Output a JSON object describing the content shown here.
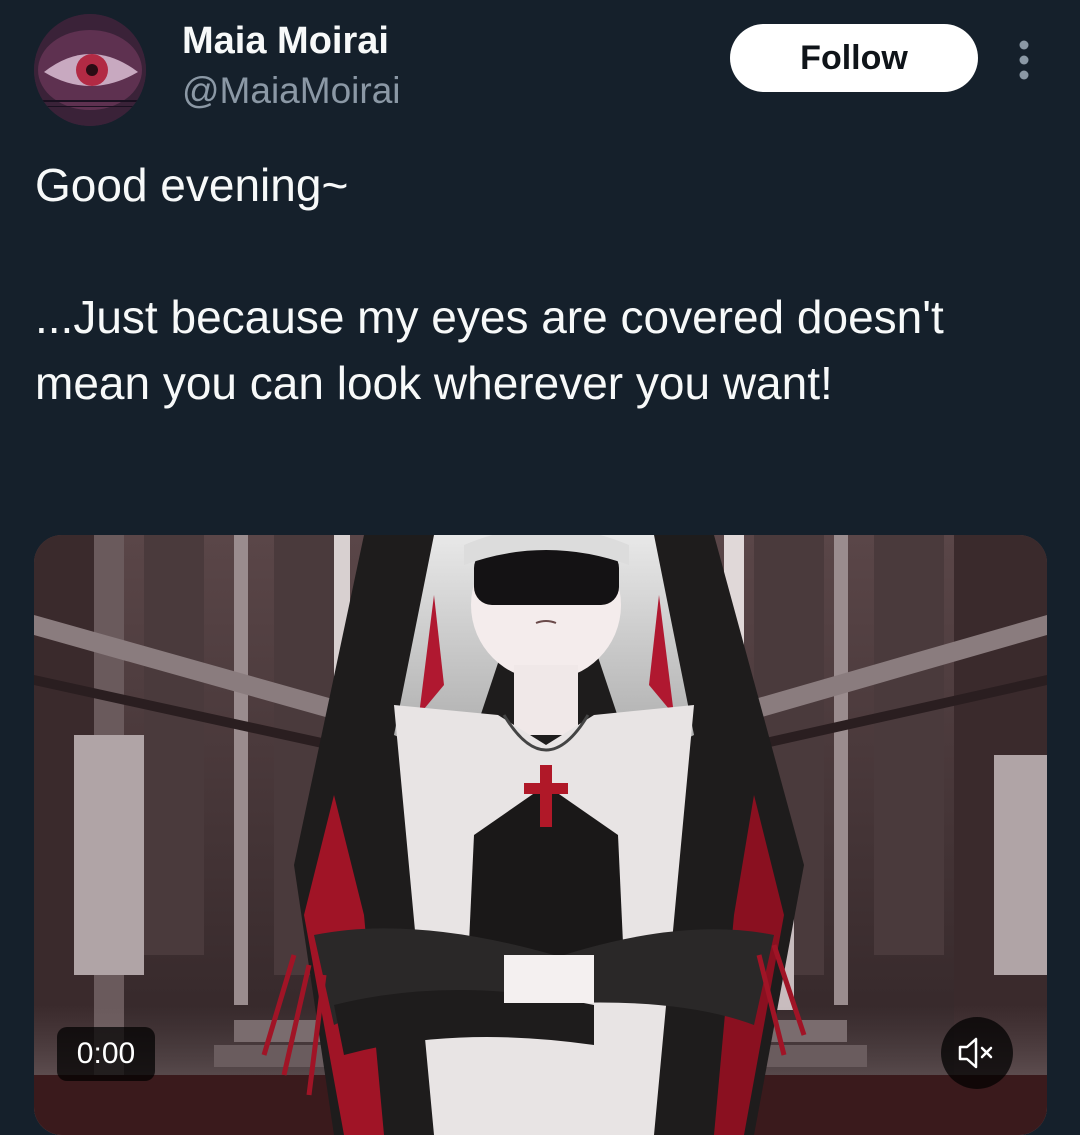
{
  "author": {
    "display_name": "Maia Moirai",
    "handle": "@MaiaMoirai"
  },
  "actions": {
    "follow_label": "Follow",
    "more_icon": "more-vertical-icon"
  },
  "tweet": {
    "text": "Good evening~\n\n...Just because my eyes are covered doesn't mean you can look wherever you want!"
  },
  "media": {
    "type": "video",
    "timestamp": "0:00",
    "muted": true,
    "mute_icon": "speaker-muted-icon"
  },
  "colors": {
    "background": "#15202b",
    "text_primary": "#f7f9f9",
    "text_secondary": "#8b98a5",
    "follow_button_bg": "#ffffff",
    "follow_button_text": "#0f1419"
  }
}
